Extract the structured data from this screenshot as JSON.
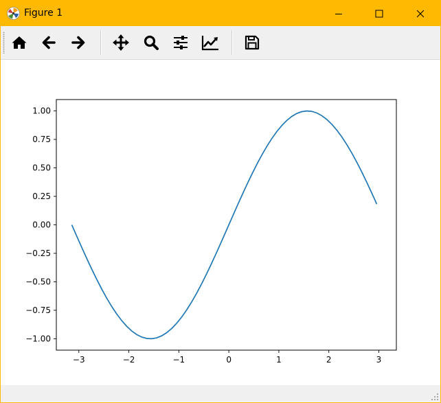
{
  "window": {
    "title": "Figure 1"
  },
  "titlebar_buttons": [
    {
      "name": "minimize-button",
      "icon": "minimize-icon"
    },
    {
      "name": "maximize-button",
      "icon": "maximize-icon"
    },
    {
      "name": "close-button",
      "icon": "close-icon"
    }
  ],
  "toolbar": {
    "buttons": [
      {
        "name": "home-button",
        "icon": "home-icon"
      },
      {
        "name": "back-button",
        "icon": "arrow-left-icon"
      },
      {
        "name": "forward-button",
        "icon": "arrow-right-icon"
      },
      {
        "name": "pan-button",
        "icon": "move-icon"
      },
      {
        "name": "zoom-button",
        "icon": "magnifier-icon"
      },
      {
        "name": "subplots-button",
        "icon": "sliders-icon"
      },
      {
        "name": "edit-axis-button",
        "icon": "trend-chart-icon"
      },
      {
        "name": "save-button",
        "icon": "floppy-disk-icon"
      }
    ]
  },
  "colors": {
    "titlebar": "#ffb900",
    "toolbar": "#f0f0f0",
    "line": "#1f77b4",
    "icon": "#000000"
  },
  "chart_data": {
    "type": "line",
    "function": "y = sin(x)",
    "x_range": [
      -3.14159,
      3.04159
    ],
    "step": 0.1,
    "xlim": [
      -3.4505,
      3.3505
    ],
    "ylim": [
      -1.1,
      1.1
    ],
    "xticks": [
      -3,
      -2,
      -1,
      0,
      1,
      2,
      3
    ],
    "xtick_labels": [
      "−3",
      "−2",
      "−1",
      "0",
      "1",
      "2",
      "3"
    ],
    "yticks": [
      -1.0,
      -0.75,
      -0.5,
      -0.25,
      0.0,
      0.25,
      0.5,
      0.75,
      1.0
    ],
    "ytick_labels": [
      "−1.00",
      "−0.75",
      "−0.50",
      "−0.25",
      "0.00",
      "0.25",
      "0.50",
      "0.75",
      "1.00"
    ],
    "grid": false,
    "title": "",
    "xlabel": "",
    "ylabel": "",
    "series": [
      {
        "color": "#1f77b4"
      }
    ]
  }
}
